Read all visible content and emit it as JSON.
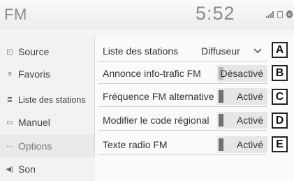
{
  "header": {
    "title": "FM",
    "clock": "5:52",
    "status_icons": [
      "signal-icon",
      "battery-icon",
      "bluetooth-icon"
    ]
  },
  "sidebar": {
    "items": [
      {
        "label": "Source",
        "icon": "source-icon"
      },
      {
        "label": "Favoris",
        "icon": "favorites-icon"
      },
      {
        "label": "Liste des stations",
        "icon": "station-list-icon"
      },
      {
        "label": "Manuel",
        "icon": "manual-icon"
      },
      {
        "label": "Options",
        "icon": "options-icon",
        "active": true
      },
      {
        "label": "Son",
        "icon": "speaker-icon"
      }
    ]
  },
  "options": [
    {
      "label": "Liste des stations",
      "value": "Diffuseur",
      "type": "dropdown",
      "callout": "A"
    },
    {
      "label": "Annonce info-trafic FM",
      "value": "Désactivé",
      "type": "toggle",
      "on": false,
      "callout": "B"
    },
    {
      "label": "Fréquence FM alternative",
      "value": "Activé",
      "type": "toggle",
      "on": true,
      "callout": "C"
    },
    {
      "label": "Modifier le code régional",
      "value": "Activé",
      "type": "toggle",
      "on": true,
      "callout": "D"
    },
    {
      "label": "Texte radio FM",
      "value": "Activé",
      "type": "toggle",
      "on": true,
      "callout": "E"
    }
  ],
  "colors": {
    "background": "#f4f4f4",
    "text": "#333333",
    "toggle_on": "#707070",
    "toggle_off": "#b8b8b8"
  }
}
